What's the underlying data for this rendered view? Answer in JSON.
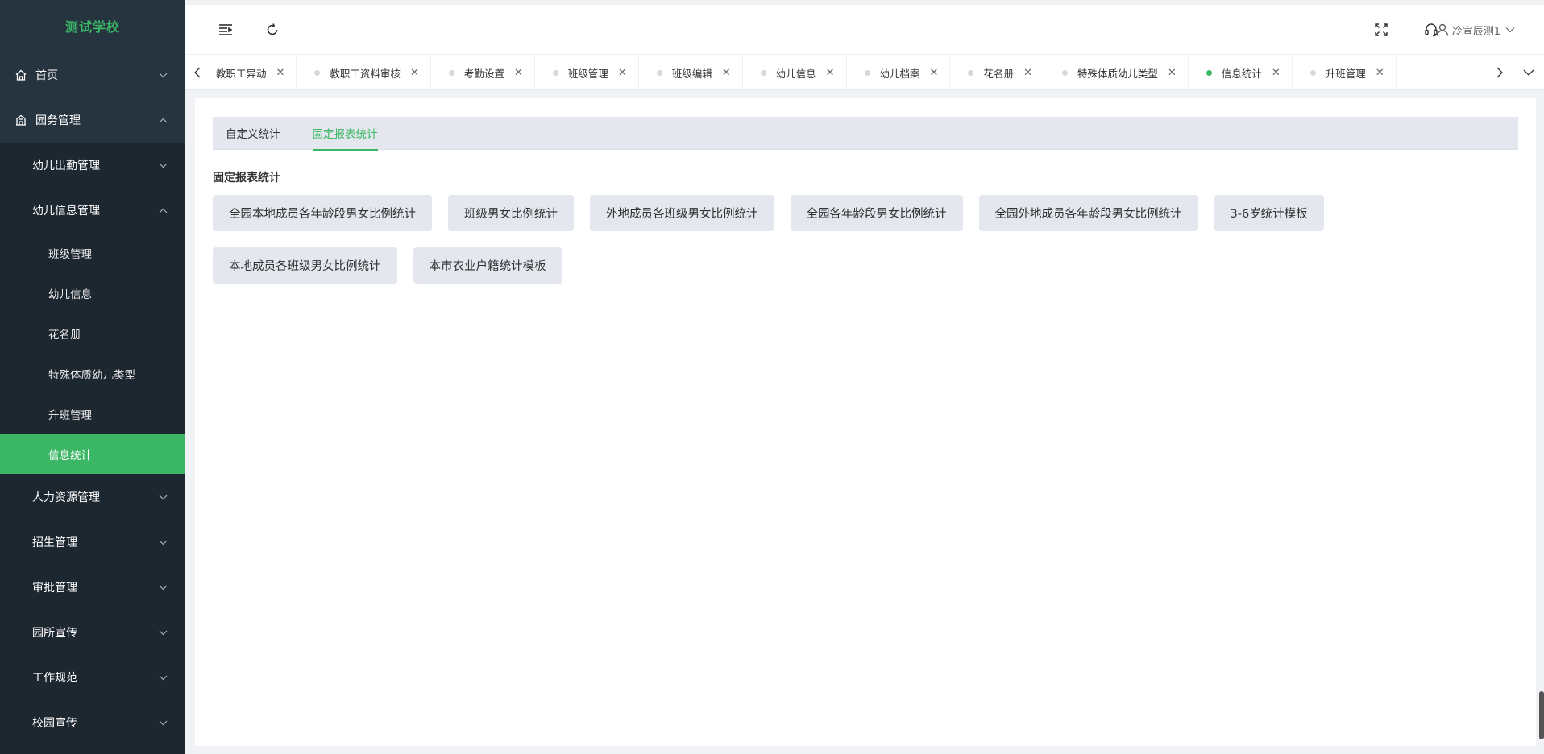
{
  "app": {
    "school_name": "测试学校"
  },
  "sidebar": {
    "items": [
      {
        "label": "首页",
        "icon": "home-icon",
        "expanded": false
      },
      {
        "label": "园务管理",
        "icon": "building-icon",
        "expanded": true
      }
    ],
    "sub": [
      {
        "label": "幼儿出勤管理",
        "expanded": false
      },
      {
        "label": "幼儿信息管理",
        "expanded": true
      }
    ],
    "leaf": [
      {
        "label": "班级管理"
      },
      {
        "label": "幼儿信息"
      },
      {
        "label": "花名册"
      },
      {
        "label": "特殊体质幼儿类型"
      },
      {
        "label": "升班管理"
      },
      {
        "label": "信息统计",
        "active": true
      }
    ],
    "rest": [
      {
        "label": "人力资源管理"
      },
      {
        "label": "招生管理"
      },
      {
        "label": "审批管理"
      },
      {
        "label": "园所宣传"
      },
      {
        "label": "工作规范"
      },
      {
        "label": "校园宣传"
      }
    ]
  },
  "header": {
    "user_name": "冷宣辰测1"
  },
  "tabs": [
    {
      "label": "教职工异动",
      "dot": false
    },
    {
      "label": "教职工资料审核"
    },
    {
      "label": "考勤设置"
    },
    {
      "label": "班级管理"
    },
    {
      "label": "班级编辑"
    },
    {
      "label": "幼儿信息"
    },
    {
      "label": "幼儿档案"
    },
    {
      "label": "花名册"
    },
    {
      "label": "特殊体质幼儿类型"
    },
    {
      "label": "信息统计",
      "active": true
    },
    {
      "label": "升班管理"
    }
  ],
  "content": {
    "subtabs": [
      {
        "label": "自定义统计"
      },
      {
        "label": "固定报表统计",
        "active": true
      }
    ],
    "section_title": "固定报表统计",
    "buttons": [
      "全园本地成员各年龄段男女比例统计",
      "班级男女比例统计",
      "外地成员各班级男女比例统计",
      "全园各年龄段男女比例统计",
      "全园外地成员各年龄段男女比例统计",
      "3-6岁统计模板",
      "本地成员各班级男女比例统计",
      "本市农业户籍统计模板"
    ]
  },
  "colors": {
    "accent": "#3bb665",
    "sidebar_bg": "#1d2730",
    "sidebar_bg_light": "#263440"
  }
}
